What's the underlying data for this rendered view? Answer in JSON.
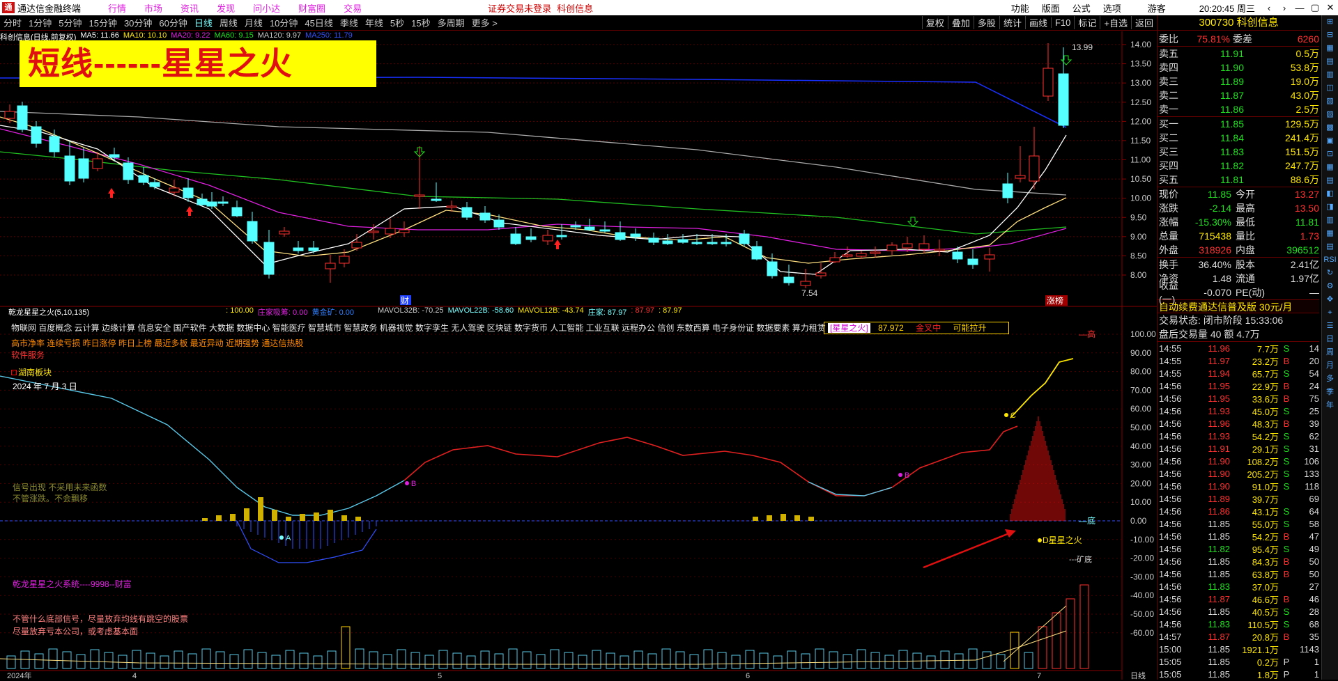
{
  "titlebar": {
    "app": "通达信金融终端",
    "menu": [
      "行情",
      "市场",
      "资讯",
      "发现",
      "问小达",
      "财富圈",
      "交易"
    ],
    "warning": "证券交易未登录",
    "stockname": "科创信息",
    "right": [
      "功能",
      "版面",
      "公式",
      "选项",
      "游客",
      "20:20:45 周三"
    ],
    "nav_left": "‹",
    "nav_right": "›",
    "win_min": "—",
    "win_max": "▢",
    "win_close": "✕"
  },
  "periodbar": {
    "items": [
      "分时",
      "1分钟",
      "5分钟",
      "15分钟",
      "30分钟",
      "60分钟",
      "日线",
      "周线",
      "月线",
      "10分钟",
      "45日线",
      "季线",
      "年线",
      "5秒",
      "15秒",
      "多周期",
      "更多 >"
    ],
    "active": 6,
    "tools": [
      "复权",
      "叠加",
      "多股",
      "统计",
      "画线",
      "F10",
      "标记",
      "+自选",
      "返回"
    ]
  },
  "main": {
    "stock_label": "科创信息(日线,前复权)",
    "ma5": "MA5: 11.66",
    "ma10": "MA10: 10.10",
    "ma20": "MA20: 9.22",
    "ma60": "MA60: 9.15",
    "ma120": "MA120: 9.97",
    "ma250": "MA250: 11.79",
    "banner": "短线------星星之火",
    "high_label": "13.99",
    "low_label": "7.54",
    "cai_marker": "财",
    "zhangting": "涨榜",
    "price_ticks": [
      "14.00",
      "13.50",
      "13.00",
      "12.50",
      "12.00",
      "11.50",
      "11.00",
      "10.50",
      "10.00",
      "9.50",
      "9.00",
      "8.50",
      "8.00"
    ]
  },
  "sub": {
    "name": "乾龙星星之火(5,10,135)",
    "v1": ": 100.00",
    "v2": "庄家吸筹: 0.00",
    "v3": "黄金矿: 0.00",
    "v4": "MAVOL32B: -70.25",
    "v5": "MAVOL22B: -58.60",
    "v6": "MAVOL12B: -43.74",
    "v7": "庄家: 87.97",
    "v8": ": 87.97",
    "v9": ": 87.97",
    "ticks": [
      "100.00",
      "90.00",
      "80.00",
      "70.00",
      "60.00",
      "50.00",
      "40.00",
      "30.00",
      "20.00",
      "10.00",
      "0.00",
      "-10.00",
      "-20.00",
      "-30.00",
      "-40.00",
      "-50.00",
      "-60.00"
    ],
    "high_tag": "—高",
    "low_tag": "—底",
    "mine_tag": "---矿底"
  },
  "concepts": {
    "line1": "物联网 百度概念 云计算 边缘计算 信息安全 国产软件 大数据 数据中心 智能医疗 智慧城市 智慧政务 机器视觉 数字孪生 无人驾驶 区块链 数字货币 人工智能 工业互联 远程办公 信创 东数西算 电子身份证 数据要素 算力租赁",
    "hl": "[星星之火]",
    "val": "87.972",
    "gold": "金叉中",
    "rise": "可能拉升",
    "line2": "高市净率 连续亏损 昨日涨停 昨日上榜 最近多板 最近异动 近期强势 通达信热股",
    "line3": "软件服务",
    "sector": "湖南板块",
    "date": "2024 年 7 月 3 日",
    "sig1": "信号出现  不采用未来函数",
    "sig2": "不管涨跌。不会飘移",
    "sysname": "乾龙星星之火系统----9998--财富",
    "note1": "不管什么底部信号，尽量放弃均线有跳空的股票",
    "note2": "尽量放弃亏本公司，或考虑基本面",
    "markA": "A",
    "markB1": "B",
    "markB2": "B",
    "markC": "C",
    "markD": "D星星之火"
  },
  "axis_bottom": {
    "labels": [
      "2024年",
      "4",
      "5",
      "6",
      "7"
    ],
    "right": "日线"
  },
  "right": {
    "code_name": "300730 科创信息",
    "weibi": {
      "l": "委比",
      "v": "75.81%",
      "l2": "委差",
      "v2": "6260"
    },
    "asks": [
      {
        "l": "卖五",
        "p": "11.91",
        "v": "0.5万"
      },
      {
        "l": "卖四",
        "p": "11.90",
        "v": "53.8万"
      },
      {
        "l": "卖三",
        "p": "11.89",
        "v": "19.0万"
      },
      {
        "l": "卖二",
        "p": "11.87",
        "v": "43.0万"
      },
      {
        "l": "卖一",
        "p": "11.86",
        "v": "2.5万"
      }
    ],
    "bids": [
      {
        "l": "买一",
        "p": "11.85",
        "v": "129.5万"
      },
      {
        "l": "买二",
        "p": "11.84",
        "v": "241.4万"
      },
      {
        "l": "买三",
        "p": "11.83",
        "v": "151.5万"
      },
      {
        "l": "买四",
        "p": "11.82",
        "v": "247.7万"
      },
      {
        "l": "买五",
        "p": "11.81",
        "v": "88.6万"
      }
    ],
    "stats": [
      [
        "现价",
        "11.85",
        "今开",
        "13.27"
      ],
      [
        "涨跌",
        "-2.14",
        "最高",
        "13.50"
      ],
      [
        "涨幅",
        "-15.30%",
        "最低",
        "11.81"
      ],
      [
        "总量",
        "715438",
        "量比",
        "1.73"
      ],
      [
        "外盘",
        "318926",
        "内盘",
        "396512"
      ],
      [
        "换手",
        "36.40%",
        "股本",
        "2.41亿"
      ],
      [
        "净资",
        "1.48",
        "流通",
        "1.97亿"
      ],
      [
        "收益(一)",
        "-0.070",
        "PE(动)",
        "—"
      ]
    ],
    "ad": "自动续费通达信普及版  30元/月",
    "state": "交易状态: 闭市阶段 15:33:06",
    "after": "盘后交易量 40 额 4.7万",
    "ticks": [
      [
        "14:55",
        "11.96",
        "7.7万",
        "S",
        "14"
      ],
      [
        "14:55",
        "11.97",
        "23.2万",
        "B",
        "20"
      ],
      [
        "14:55",
        "11.94",
        "65.7万",
        "S",
        "54"
      ],
      [
        "14:56",
        "11.95",
        "22.9万",
        "B",
        "24"
      ],
      [
        "14:56",
        "11.95",
        "33.6万",
        "B",
        "75"
      ],
      [
        "14:56",
        "11.93",
        "45.0万",
        "S",
        "25"
      ],
      [
        "14:56",
        "11.96",
        "48.3万",
        "B",
        "39"
      ],
      [
        "14:56",
        "11.93",
        "54.2万",
        "S",
        "62"
      ],
      [
        "14:56",
        "11.91",
        "29.1万",
        "S",
        "31"
      ],
      [
        "14:56",
        "11.90",
        "108.2万",
        "S",
        "106"
      ],
      [
        "14:56",
        "11.90",
        "205.2万",
        "S",
        "133"
      ],
      [
        "14:56",
        "11.90",
        "91.0万",
        "S",
        "118"
      ],
      [
        "14:56",
        "11.89",
        "39.7万",
        "",
        "69"
      ],
      [
        "14:56",
        "11.86",
        "43.1万",
        "S",
        "64"
      ],
      [
        "14:56",
        "11.85",
        "55.0万",
        "S",
        "58"
      ],
      [
        "14:56",
        "11.85",
        "54.2万",
        "B",
        "47"
      ],
      [
        "14:56",
        "11.82",
        "95.4万",
        "S",
        "49"
      ],
      [
        "14:56",
        "11.85",
        "84.3万",
        "B",
        "50"
      ],
      [
        "14:56",
        "11.85",
        "63.8万",
        "B",
        "50"
      ],
      [
        "14:56",
        "11.83",
        "37.0万",
        "",
        "27"
      ],
      [
        "14:56",
        "11.87",
        "46.6万",
        "B",
        "46"
      ],
      [
        "14:56",
        "11.85",
        "40.5万",
        "S",
        "28"
      ],
      [
        "14:56",
        "11.83",
        "110.5万",
        "S",
        "68"
      ],
      [
        "14:57",
        "11.87",
        "20.8万",
        "B",
        "35"
      ],
      [
        "15:00",
        "11.85",
        "1921.1万",
        "",
        "1143"
      ],
      [
        "15:05",
        "11.85",
        "0.2万",
        "P",
        "1"
      ],
      [
        "15:05",
        "11.85",
        "1.8万",
        "P",
        "1"
      ]
    ],
    "side_icons": [
      "⊞",
      "⊟",
      "▦",
      "▤",
      "▥",
      "◫",
      "▧",
      "▨",
      "▩",
      "▣",
      "⊡",
      "▦",
      "▤",
      "◧",
      "◨",
      "▥",
      "▦",
      "▤",
      "RSI",
      "↻",
      "⚙",
      "✥",
      "⌖",
      "☰",
      "日",
      "周",
      "月",
      "多",
      "季",
      "年"
    ]
  }
}
